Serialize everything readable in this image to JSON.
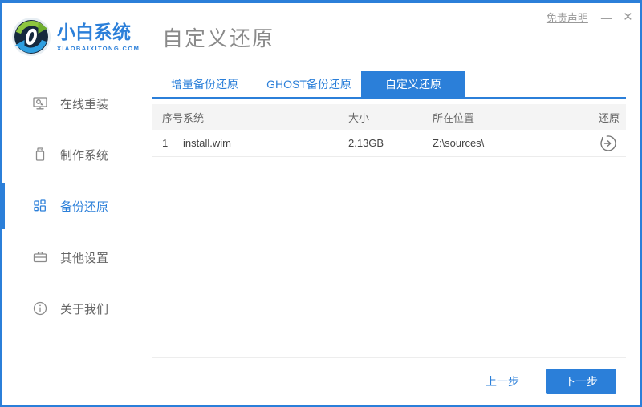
{
  "window": {
    "disclaimer": "免责声明",
    "minimize_glyph": "—",
    "close_glyph": "×",
    "accent_color": "#2b7fd9"
  },
  "brand": {
    "name": "小白系统",
    "domain": "XIAOBAIXITONG.COM"
  },
  "header": {
    "title": "自定义还原"
  },
  "sidebar": {
    "items": [
      {
        "label": "在线重装",
        "icon": "monitor-icon",
        "active": false
      },
      {
        "label": "制作系统",
        "icon": "usb-drive-icon",
        "active": false
      },
      {
        "label": "备份还原",
        "icon": "grid-icon",
        "active": true
      },
      {
        "label": "其他设置",
        "icon": "briefcase-icon",
        "active": false
      },
      {
        "label": "关于我们",
        "icon": "info-icon",
        "active": false
      }
    ]
  },
  "tabs": [
    {
      "label": "增量备份还原",
      "active": false
    },
    {
      "label": "GHOST备份还原",
      "active": false
    },
    {
      "label": "自定义还原",
      "active": true
    }
  ],
  "table": {
    "columns": [
      "序号",
      "系统",
      "大小",
      "所在位置",
      "还原"
    ],
    "rows": [
      {
        "index": "1",
        "system": "install.wim",
        "size": "2.13GB",
        "location": "Z:\\sources\\",
        "action_icon": "restore-icon"
      }
    ]
  },
  "footer": {
    "back_label": "上一步",
    "next_label": "下一步"
  }
}
